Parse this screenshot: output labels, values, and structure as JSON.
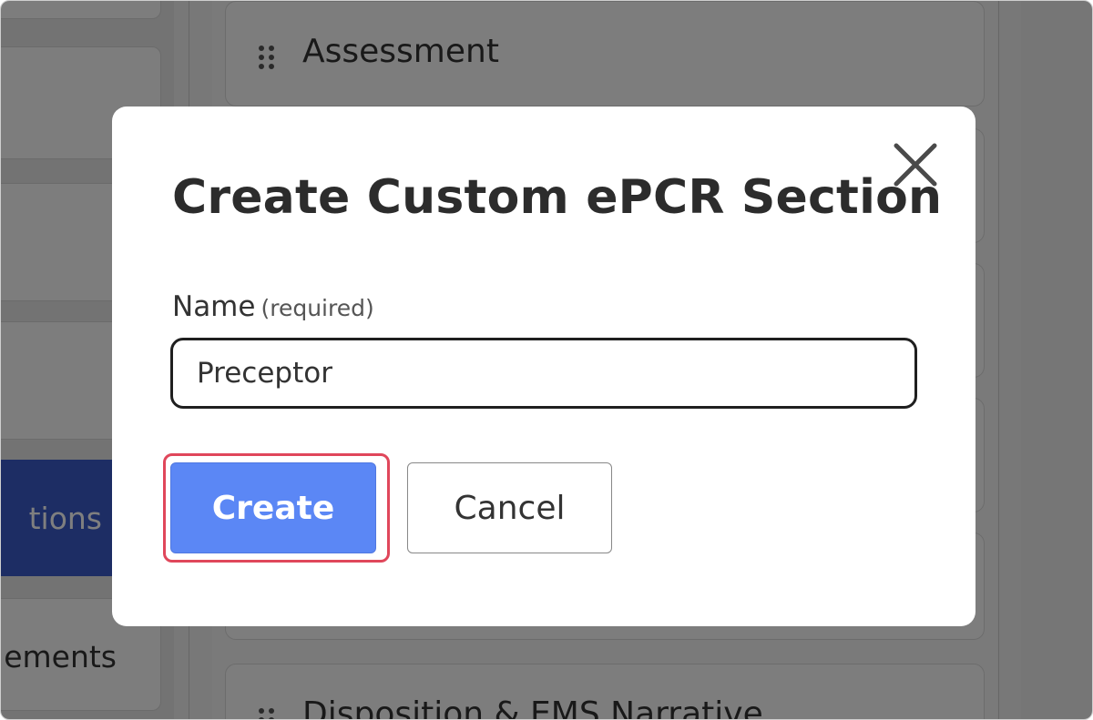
{
  "background": {
    "nav_items": [
      {
        "label": ""
      },
      {
        "label": ""
      },
      {
        "label": ""
      },
      {
        "label": ""
      },
      {
        "label": "tions",
        "active": true
      },
      {
        "label": "ements"
      }
    ],
    "sections": [
      {
        "title": "Assessment"
      },
      {
        "title": ""
      },
      {
        "title": ""
      },
      {
        "title": ""
      },
      {
        "title": ""
      },
      {
        "title": "Disposition & EMS Narrative"
      }
    ]
  },
  "modal": {
    "title": "Create Custom ePCR Section",
    "close_icon": "close-icon",
    "name_field": {
      "label": "Name",
      "required_hint": "(required)",
      "value": "Preceptor"
    },
    "buttons": {
      "create_label": "Create",
      "cancel_label": "Cancel"
    }
  },
  "colors": {
    "primary": "#5b87f5",
    "active_nav": "#3a5bc8",
    "focus_ring": "#e0475b",
    "overlay": "rgba(0,0,0,0.5)"
  }
}
